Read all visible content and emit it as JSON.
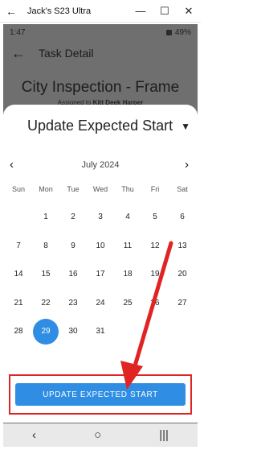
{
  "window": {
    "title": "Jack's S23 Ultra",
    "back": "←",
    "minimize": "—",
    "maximize": "☐",
    "close": "✕"
  },
  "status_bar": {
    "time": "1:47",
    "battery": "49%"
  },
  "app_bar": {
    "title": "Task Detail"
  },
  "task": {
    "title": "City Inspection - Frame",
    "assigned_prefix": "Assigned to",
    "assigned_name": "Kitt Deek Harper"
  },
  "sheet": {
    "title": "Update Expected Start",
    "month": "July 2024",
    "weekdays": [
      "Sun",
      "Mon",
      "Tue",
      "Wed",
      "Thu",
      "Fri",
      "Sat"
    ],
    "days": [
      "",
      "1",
      "2",
      "3",
      "4",
      "5",
      "6",
      "7",
      "8",
      "9",
      "10",
      "11",
      "12",
      "13",
      "14",
      "15",
      "16",
      "17",
      "18",
      "19",
      "20",
      "21",
      "22",
      "23",
      "24",
      "25",
      "26",
      "27",
      "28",
      "29",
      "30",
      "31",
      "",
      "",
      ""
    ],
    "selected_day": "29",
    "cta_label": "UPDATE EXPECTED START"
  },
  "nav": {
    "back": "‹",
    "home": "○",
    "recents": "|||"
  },
  "colors": {
    "accent": "#2f8de4",
    "annotation": "#e02424",
    "scrim": "#6f6f6f"
  }
}
